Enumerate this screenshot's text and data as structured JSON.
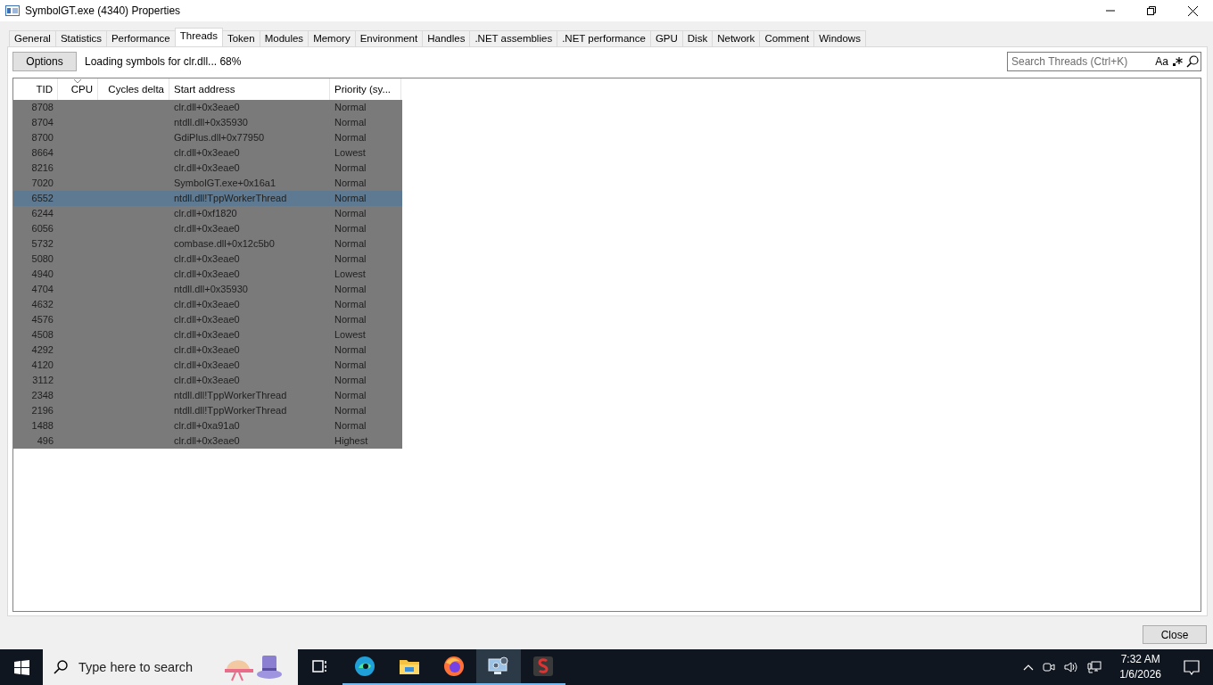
{
  "window": {
    "title": "SymbolGT.exe (4340) Properties"
  },
  "tabs": [
    {
      "label": "General",
      "selected": false
    },
    {
      "label": "Statistics",
      "selected": false
    },
    {
      "label": "Performance",
      "selected": false
    },
    {
      "label": "Threads",
      "selected": true
    },
    {
      "label": "Token",
      "selected": false
    },
    {
      "label": "Modules",
      "selected": false
    },
    {
      "label": "Memory",
      "selected": false
    },
    {
      "label": "Environment",
      "selected": false
    },
    {
      "label": "Handles",
      "selected": false
    },
    {
      "label": ".NET assemblies",
      "selected": false
    },
    {
      "label": ".NET performance",
      "selected": false
    },
    {
      "label": "GPU",
      "selected": false
    },
    {
      "label": "Disk",
      "selected": false
    },
    {
      "label": "Network",
      "selected": false
    },
    {
      "label": "Comment",
      "selected": false
    },
    {
      "label": "Windows",
      "selected": false
    }
  ],
  "toolbar": {
    "options_button": "Options",
    "status": "Loading symbols for clr.dll... 68%",
    "search": {
      "placeholder": "Search Threads (Ctrl+K)",
      "case_toggle": "Aa"
    }
  },
  "table": {
    "columns": [
      "TID",
      "CPU",
      "Cycles delta",
      "Start address",
      "Priority (sy..."
    ],
    "rows": [
      {
        "tid": "8708",
        "start": "clr.dll+0x3eae0",
        "priority": "Normal",
        "selected": false
      },
      {
        "tid": "8704",
        "start": "ntdll.dll+0x35930",
        "priority": "Normal",
        "selected": false
      },
      {
        "tid": "8700",
        "start": "GdiPlus.dll+0x77950",
        "priority": "Normal",
        "selected": false
      },
      {
        "tid": "8664",
        "start": "clr.dll+0x3eae0",
        "priority": "Lowest",
        "selected": false
      },
      {
        "tid": "8216",
        "start": "clr.dll+0x3eae0",
        "priority": "Normal",
        "selected": false
      },
      {
        "tid": "7020",
        "start": "SymbolGT.exe+0x16a1",
        "priority": "Normal",
        "selected": false
      },
      {
        "tid": "6552",
        "start": "ntdll.dll!TppWorkerThread",
        "priority": "Normal",
        "selected": true
      },
      {
        "tid": "6244",
        "start": "clr.dll+0xf1820",
        "priority": "Normal",
        "selected": false
      },
      {
        "tid": "6056",
        "start": "clr.dll+0x3eae0",
        "priority": "Normal",
        "selected": false
      },
      {
        "tid": "5732",
        "start": "combase.dll+0x12c5b0",
        "priority": "Normal",
        "selected": false
      },
      {
        "tid": "5080",
        "start": "clr.dll+0x3eae0",
        "priority": "Normal",
        "selected": false
      },
      {
        "tid": "4940",
        "start": "clr.dll+0x3eae0",
        "priority": "Lowest",
        "selected": false
      },
      {
        "tid": "4704",
        "start": "ntdll.dll+0x35930",
        "priority": "Normal",
        "selected": false
      },
      {
        "tid": "4632",
        "start": "clr.dll+0x3eae0",
        "priority": "Normal",
        "selected": false
      },
      {
        "tid": "4576",
        "start": "clr.dll+0x3eae0",
        "priority": "Normal",
        "selected": false
      },
      {
        "tid": "4508",
        "start": "clr.dll+0x3eae0",
        "priority": "Lowest",
        "selected": false
      },
      {
        "tid": "4292",
        "start": "clr.dll+0x3eae0",
        "priority": "Normal",
        "selected": false
      },
      {
        "tid": "4120",
        "start": "clr.dll+0x3eae0",
        "priority": "Normal",
        "selected": false
      },
      {
        "tid": "3112",
        "start": "clr.dll+0x3eae0",
        "priority": "Normal",
        "selected": false
      },
      {
        "tid": "2348",
        "start": "ntdll.dll!TppWorkerThread",
        "priority": "Normal",
        "selected": false
      },
      {
        "tid": "2196",
        "start": "ntdll.dll!TppWorkerThread",
        "priority": "Normal",
        "selected": false
      },
      {
        "tid": "1488",
        "start": "clr.dll+0xa91a0",
        "priority": "Normal",
        "selected": false
      },
      {
        "tid": "496",
        "start": "clr.dll+0x3eae0",
        "priority": "Highest",
        "selected": false
      }
    ]
  },
  "close_button": "Close",
  "taskbar": {
    "search_placeholder": "Type here to search",
    "apps": [
      {
        "kind": "taskview",
        "selected": false
      },
      {
        "kind": "edge",
        "selected": false
      },
      {
        "kind": "explorer",
        "selected": false
      },
      {
        "kind": "firefox",
        "selected": false
      },
      {
        "kind": "sysinfo",
        "selected": true
      },
      {
        "kind": "s-app",
        "selected": false
      }
    ],
    "time": "7:32 AM",
    "date": "1/6/2026"
  }
}
